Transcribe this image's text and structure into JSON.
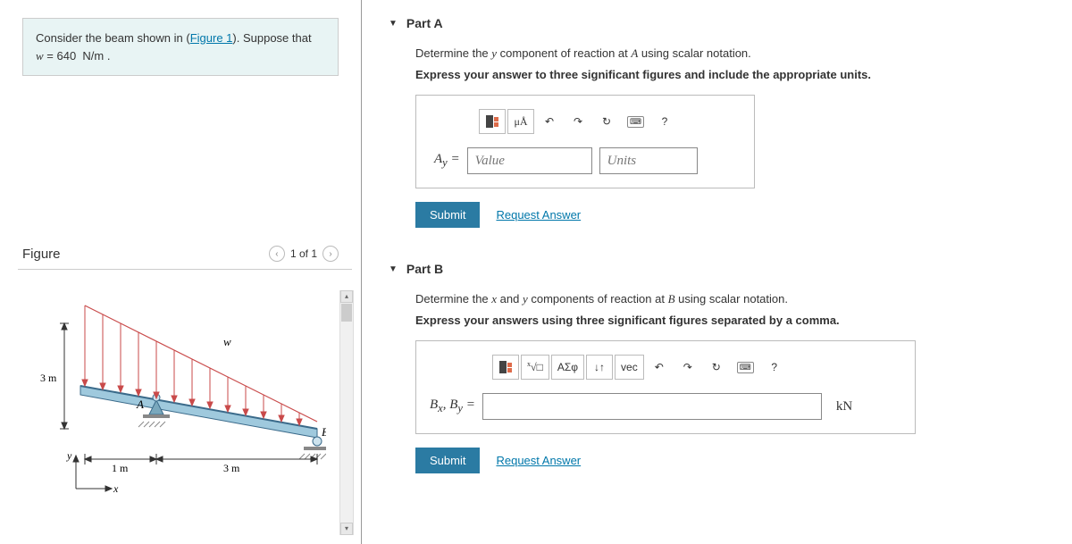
{
  "problem": {
    "text_pre": "Consider the beam shown in (",
    "figure_link": "Figure 1",
    "text_post": "). Suppose that ",
    "equation": "w = 640  N/m .",
    "var": "w"
  },
  "figure": {
    "title": "Figure",
    "nav_text": "1 of 1",
    "labels": {
      "w": "w",
      "A": "A",
      "B": "B",
      "dim_3m_v": "3 m",
      "dim_1m": "1 m",
      "dim_3m_h": "3 m",
      "y": "y",
      "x": "x"
    }
  },
  "partA": {
    "title": "Part A",
    "prompt": "Determine the y component of reaction at A using scalar notation.",
    "prompt_var": "y",
    "prompt_var2": "A",
    "instruction": "Express your answer to three significant figures and include the appropriate units.",
    "toolbar": {
      "units_btn": "μÅ",
      "help_btn": "?"
    },
    "label": "A",
    "label_sub": "y",
    "equals": " = ",
    "value_placeholder": "Value",
    "units_placeholder": "Units",
    "submit": "Submit",
    "request": "Request Answer"
  },
  "partB": {
    "title": "Part B",
    "prompt_pre": "Determine the ",
    "prompt_x": "x",
    "prompt_mid": " and ",
    "prompt_y": "y",
    "prompt_post": " components of reaction at ",
    "prompt_B": "B",
    "prompt_end": " using scalar notation.",
    "instruction": "Express your answers using three significant figures separated by a comma.",
    "toolbar": {
      "sigma_btn": "ΑΣφ",
      "updown_btn": "↓↑",
      "vec_btn": "vec",
      "help_btn": "?"
    },
    "label_Bx": "B",
    "label_Bx_sub": "x",
    "label_sep": ", ",
    "label_By": "B",
    "label_By_sub": "y",
    "equals": " = ",
    "unit": "kN",
    "submit": "Submit",
    "request": "Request Answer"
  }
}
